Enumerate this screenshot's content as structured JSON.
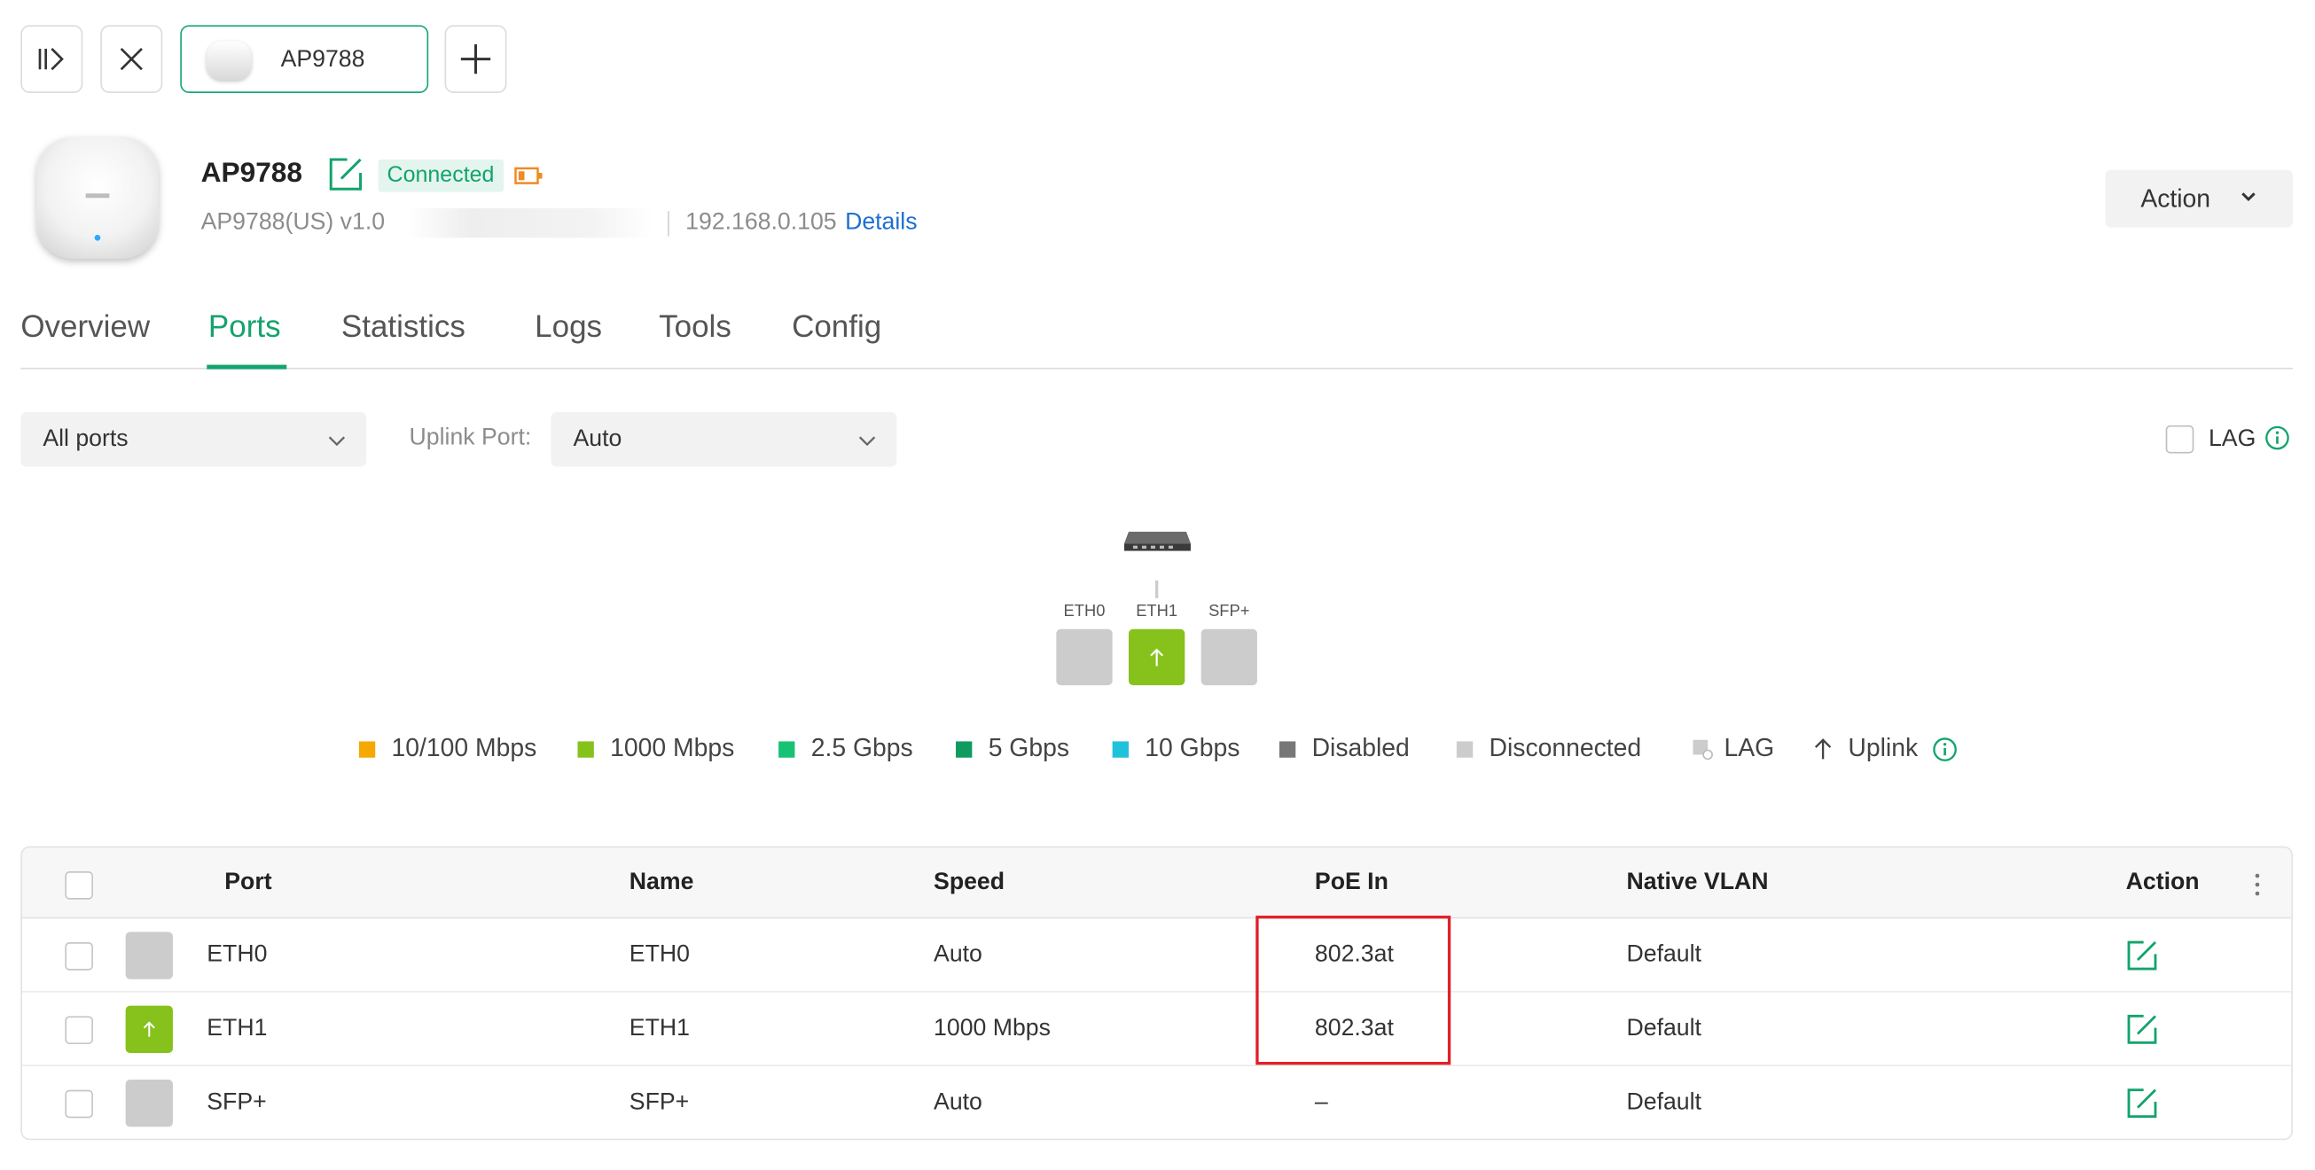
{
  "device_tab": {
    "label": "AP9788"
  },
  "device": {
    "name": "AP9788",
    "status": "Connected",
    "model": "AP9788(US) v1.0",
    "ip": "192.168.0.105",
    "details_link": "Details",
    "action_label": "Action"
  },
  "tabs": [
    "Overview",
    "Ports",
    "Statistics",
    "Logs",
    "Tools",
    "Config"
  ],
  "active_tab": "Ports",
  "filters": {
    "ports_filter": "All ports",
    "uplink_label": "Uplink Port:",
    "uplink_value": "Auto",
    "lag_label": "LAG"
  },
  "diagram": {
    "ports": [
      {
        "label": "ETH0",
        "state": "disconnected"
      },
      {
        "label": "ETH1",
        "state": "uplink-1000"
      },
      {
        "label": "SFP+",
        "state": "disconnected"
      }
    ]
  },
  "legend": [
    {
      "label": "10/100 Mbps",
      "color": "#f5a800"
    },
    {
      "label": "1000 Mbps",
      "color": "#86c21b"
    },
    {
      "label": "2.5 Gbps",
      "color": "#18c275"
    },
    {
      "label": "5 Gbps",
      "color": "#0f9a60"
    },
    {
      "label": "10 Gbps",
      "color": "#1fc2da"
    },
    {
      "label": "Disabled",
      "color": "#777777"
    },
    {
      "label": "Disconnected",
      "color": "#cccccc"
    },
    {
      "label": "LAG",
      "color": "#cccccc"
    },
    {
      "label": "Uplink",
      "color": "#444444"
    }
  ],
  "table": {
    "columns": [
      "Port",
      "Name",
      "Speed",
      "PoE In",
      "Native VLAN",
      "Action"
    ],
    "rows": [
      {
        "port": "ETH0",
        "name": "ETH0",
        "speed": "Auto",
        "poe_in": "802.3at",
        "native_vlan": "Default",
        "uplink": false
      },
      {
        "port": "ETH1",
        "name": "ETH1",
        "speed": "1000 Mbps",
        "poe_in": "802.3at",
        "native_vlan": "Default",
        "uplink": true
      },
      {
        "port": "SFP+",
        "name": "SFP+",
        "speed": "Auto",
        "poe_in": "–",
        "native_vlan": "Default",
        "uplink": false
      }
    ]
  },
  "colors": {
    "accent": "#14a36d",
    "link": "#1e6fd0",
    "port_1000": "#86c21b",
    "port_disconnected": "#cccccc",
    "highlight": "#e0202a"
  }
}
